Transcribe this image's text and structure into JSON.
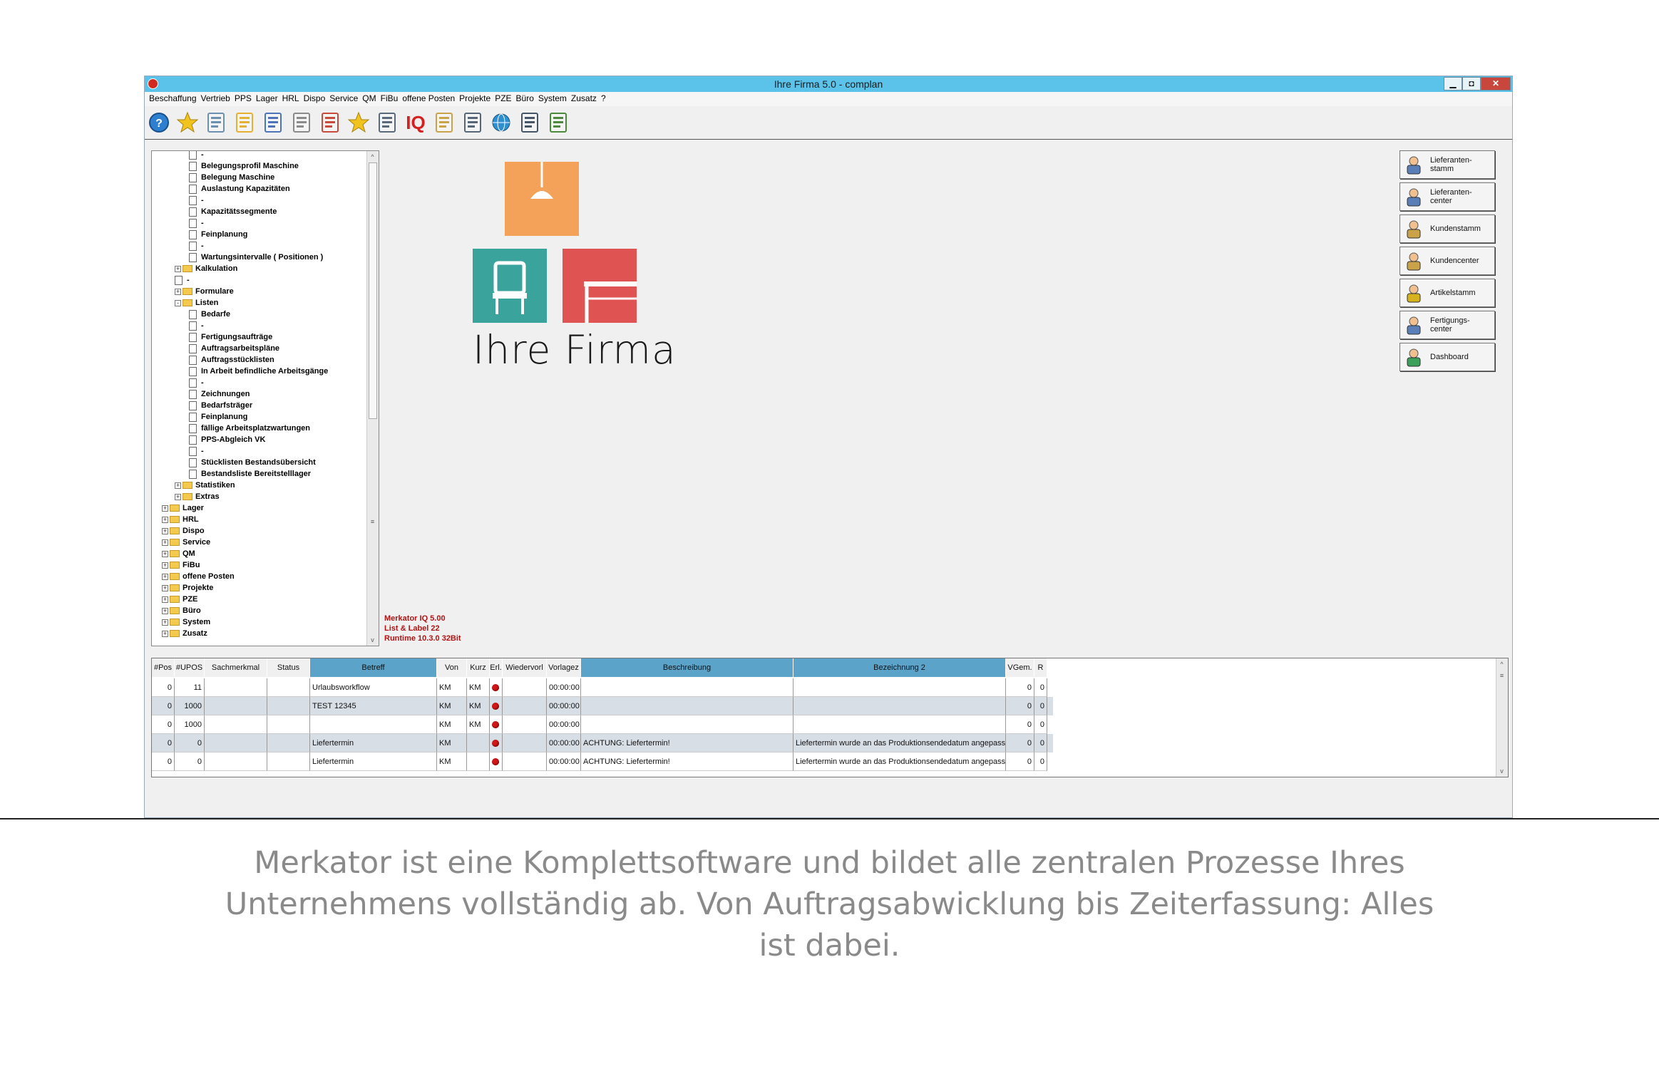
{
  "window": {
    "title": "Ihre Firma 5.0  - complan",
    "controls": {
      "minimize": "▁",
      "maximize": "◘",
      "close": "✕"
    }
  },
  "menu": [
    "Beschaffung",
    "Vertrieb",
    "PPS",
    "Lager",
    "HRL",
    "Dispo",
    "Service",
    "QM",
    "FiBu",
    "offene Posten",
    "Projekte",
    "PZE",
    "Büro",
    "System",
    "Zusatz",
    "?"
  ],
  "toolbar_icons": [
    "help-icon",
    "favorites-icon",
    "calculator-icon",
    "lock-icon",
    "clipboard-icon",
    "printer-icon",
    "calendar-icon",
    "star-icon",
    "database-icon",
    "iq-icon",
    "search-icon",
    "report-icon",
    "globe-icon",
    "list-icon",
    "exit-icon"
  ],
  "toolbar_iq_label": "IQ",
  "tree": {
    "items": [
      {
        "label": "-",
        "level": 3,
        "type": "doc"
      },
      {
        "label": "Belegungsprofil Maschine",
        "level": 3,
        "type": "doc"
      },
      {
        "label": "Belegung Maschine",
        "level": 3,
        "type": "doc"
      },
      {
        "label": "Auslastung Kapazitäten",
        "level": 3,
        "type": "doc"
      },
      {
        "label": "-",
        "level": 3,
        "type": "doc"
      },
      {
        "label": "Kapazitätssegmente",
        "level": 3,
        "type": "doc"
      },
      {
        "label": "-",
        "level": 3,
        "type": "doc"
      },
      {
        "label": "Feinplanung",
        "level": 3,
        "type": "doc"
      },
      {
        "label": "-",
        "level": 3,
        "type": "doc"
      },
      {
        "label": "Wartungsintervalle ( Positionen )",
        "level": 3,
        "type": "doc"
      },
      {
        "label": "Kalkulation",
        "level": 2,
        "type": "folder",
        "expander": "+"
      },
      {
        "label": "-",
        "level": 2,
        "type": "doc"
      },
      {
        "label": "Formulare",
        "level": 2,
        "type": "folder",
        "expander": "+"
      },
      {
        "label": "Listen",
        "level": 2,
        "type": "folder",
        "expander": "-"
      },
      {
        "label": "Bedarfe",
        "level": 3,
        "type": "doc"
      },
      {
        "label": "-",
        "level": 3,
        "type": "doc"
      },
      {
        "label": "Fertigungsaufträge",
        "level": 3,
        "type": "doc"
      },
      {
        "label": "Auftragsarbeitspläne",
        "level": 3,
        "type": "doc"
      },
      {
        "label": "Auftragsstücklisten",
        "level": 3,
        "type": "doc"
      },
      {
        "label": "In Arbeit befindliche Arbeitsgänge",
        "level": 3,
        "type": "doc"
      },
      {
        "label": "-",
        "level": 3,
        "type": "doc"
      },
      {
        "label": "Zeichnungen",
        "level": 3,
        "type": "doc"
      },
      {
        "label": "Bedarfsträger",
        "level": 3,
        "type": "doc"
      },
      {
        "label": "Feinplanung",
        "level": 3,
        "type": "doc"
      },
      {
        "label": "fällige Arbeitsplatzwartungen",
        "level": 3,
        "type": "doc"
      },
      {
        "label": "PPS-Abgleich VK",
        "level": 3,
        "type": "doc"
      },
      {
        "label": "-",
        "level": 3,
        "type": "doc"
      },
      {
        "label": "Stücklisten Bestandsübersicht",
        "level": 3,
        "type": "doc"
      },
      {
        "label": "Bestandsliste Bereitstelllager",
        "level": 3,
        "type": "doc"
      },
      {
        "label": "Statistiken",
        "level": 2,
        "type": "folder",
        "expander": "+"
      },
      {
        "label": "Extras",
        "level": 2,
        "type": "folder",
        "expander": "+"
      },
      {
        "label": "Lager",
        "level": 1,
        "type": "folder",
        "expander": "+"
      },
      {
        "label": "HRL",
        "level": 1,
        "type": "folder",
        "expander": "+"
      },
      {
        "label": "Dispo",
        "level": 1,
        "type": "folder",
        "expander": "+"
      },
      {
        "label": "Service",
        "level": 1,
        "type": "folder",
        "expander": "+"
      },
      {
        "label": "QM",
        "level": 1,
        "type": "folder",
        "expander": "+"
      },
      {
        "label": "FiBu",
        "level": 1,
        "type": "folder",
        "expander": "+"
      },
      {
        "label": "offene Posten",
        "level": 1,
        "type": "folder",
        "expander": "+"
      },
      {
        "label": "Projekte",
        "level": 1,
        "type": "folder",
        "expander": "+"
      },
      {
        "label": "PZE",
        "level": 1,
        "type": "folder",
        "expander": "+"
      },
      {
        "label": "Büro",
        "level": 1,
        "type": "folder",
        "expander": "+"
      },
      {
        "label": "System",
        "level": 1,
        "type": "folder",
        "expander": "+"
      },
      {
        "label": "Zusatz",
        "level": 1,
        "type": "folder",
        "expander": "+"
      }
    ],
    "scroll": {
      "up": "^",
      "down": "v",
      "grip": "≡"
    }
  },
  "logo": {
    "text": "Ihre Firma",
    "colors": {
      "orange": "#f4a259",
      "teal": "#3aa39c",
      "red": "#e05353"
    }
  },
  "version_info": [
    "Merkator IQ 5.00",
    "List & Label 22",
    "Runtime 10.3.0 32Bit"
  ],
  "quick_buttons": [
    {
      "label": "Lieferanten-\nstamm",
      "icon": "supplier-icon"
    },
    {
      "label": "Lieferanten-\ncenter",
      "icon": "supplier-center-icon"
    },
    {
      "label": "Kundenstamm",
      "icon": "customer-icon"
    },
    {
      "label": "Kundencenter",
      "icon": "customer-center-icon"
    },
    {
      "label": "Artikelstamm",
      "icon": "article-icon"
    },
    {
      "label": "Fertigungs-\ncenter",
      "icon": "production-icon"
    },
    {
      "label": "Dashboard",
      "icon": "dashboard-icon"
    }
  ],
  "grid": {
    "columns": [
      "#Pos",
      "#UPOS",
      "Sachmerkmal",
      "Status",
      "Betreff",
      "Von",
      "Kurz",
      "Erl.",
      "Wiedervorl",
      "Vorlagez",
      "Beschreibung",
      "Bezeichnung 2",
      "VGem.",
      "R"
    ],
    "rows": [
      [
        "0",
        "11",
        "",
        "",
        "Urlaubsworkflow",
        "KM",
        "KM",
        "dot",
        "",
        "00:00:00",
        "",
        "",
        "0",
        "0"
      ],
      [
        "0",
        "1000",
        "",
        "",
        "TEST 12345",
        "KM",
        "KM",
        "dot",
        "",
        "00:00:00",
        "",
        "",
        "0",
        "0"
      ],
      [
        "0",
        "1000",
        "",
        "",
        "",
        "KM",
        "KM",
        "dot",
        "",
        "00:00:00",
        "",
        "",
        "0",
        "0"
      ],
      [
        "0",
        "0",
        "",
        "",
        "Liefertermin",
        "KM",
        "",
        "dot",
        "",
        "00:00:00",
        "ACHTUNG: Liefertermin!",
        "Liefertermin wurde an das Produktionsendedatum angepasst !",
        "0",
        "0"
      ],
      [
        "0",
        "0",
        "",
        "",
        "Liefertermin",
        "KM",
        "",
        "dot",
        "",
        "00:00:00",
        "ACHTUNG: Liefertermin!",
        "Liefertermin wurde an das Produktionsendedatum angepasst !",
        "0",
        "0"
      ]
    ]
  },
  "caption": "Merkator ist eine Komplettsoftware und bildet alle zentralen Prozesse Ihres Unternehmens vollständig ab. Von Auftragsabwicklung bis Zeiterfassung: Alles ist dabei."
}
